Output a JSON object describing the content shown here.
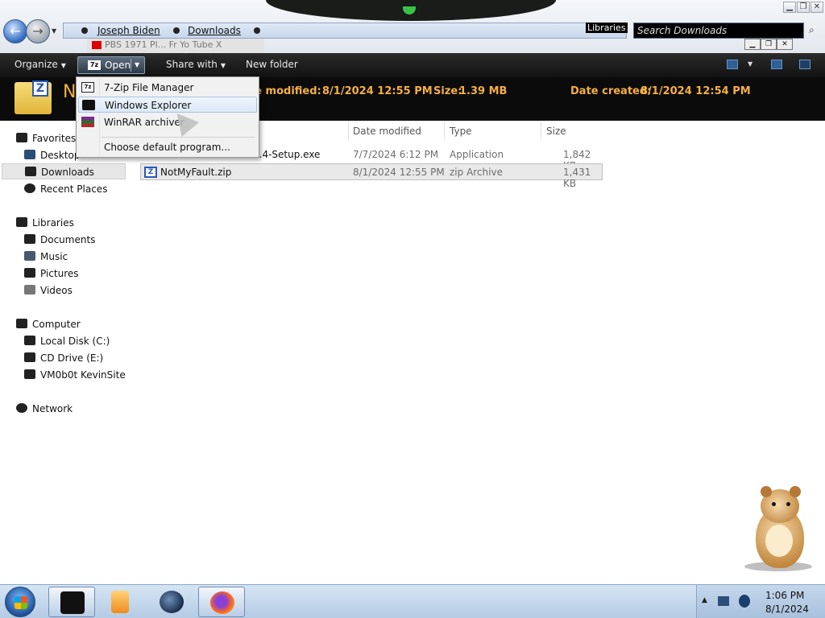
{
  "window": {
    "breadcrumbs": [
      "Joseph Biden",
      "Downloads"
    ],
    "libraries_label": "Libraries",
    "search_placeholder": "Search Downloads",
    "ghost_tab": "PBS 1971 Pl... Fr Yo Tube X"
  },
  "toolbar": {
    "organize": "Organize",
    "open": "Open",
    "share_with": "Share with",
    "new_folder": "New folder"
  },
  "details": {
    "name_initial": "N",
    "date_modified_label": "te modified:",
    "date_modified": "8/1/2024 12:55 PM",
    "size_label": "Size:",
    "size": "1.39 MB",
    "date_created_label": "Date created:",
    "date_created": "8/1/2024 12:54 PM"
  },
  "open_menu": {
    "items": [
      {
        "label": "7-Zip File Manager",
        "icon": "7zip-icon"
      },
      {
        "label": "Windows Explorer",
        "icon": "windows-explorer-icon",
        "highlighted": true
      },
      {
        "label": "WinRAR archiver",
        "icon": "winrar-icon"
      }
    ],
    "default_program": "Choose default program..."
  },
  "nav": {
    "favorites": "Favorites",
    "desktop": "Desktop",
    "downloads": "Downloads",
    "recent_places": "Recent Places",
    "libraries": "Libraries",
    "documents": "Documents",
    "music": "Music",
    "pictures": "Pictures",
    "videos": "Videos",
    "computer": "Computer",
    "local_disk": "Local Disk (C:)",
    "cd_drive": "CD Drive (E:)",
    "network_site": "VM0b0t KevinSite",
    "network": "Network"
  },
  "file_list": {
    "columns": [
      "Date modified",
      "Type",
      "Size"
    ],
    "rows": [
      {
        "name": "...4-Setup.exe",
        "date": "7/7/2024 6:12 PM",
        "type": "Application",
        "size": "1,842 KB"
      },
      {
        "name": "NotMyFault.zip",
        "date": "8/1/2024 12:55 PM",
        "type": "zip Archive",
        "size": "1,431 KB"
      }
    ]
  },
  "taskbar": {
    "time": "1:06 PM",
    "date": "8/1/2024"
  },
  "colors": {
    "accent_orange": "#f5b043",
    "command_bar": "#1a1a1a",
    "menu_highlight": "#dbe8f7"
  }
}
